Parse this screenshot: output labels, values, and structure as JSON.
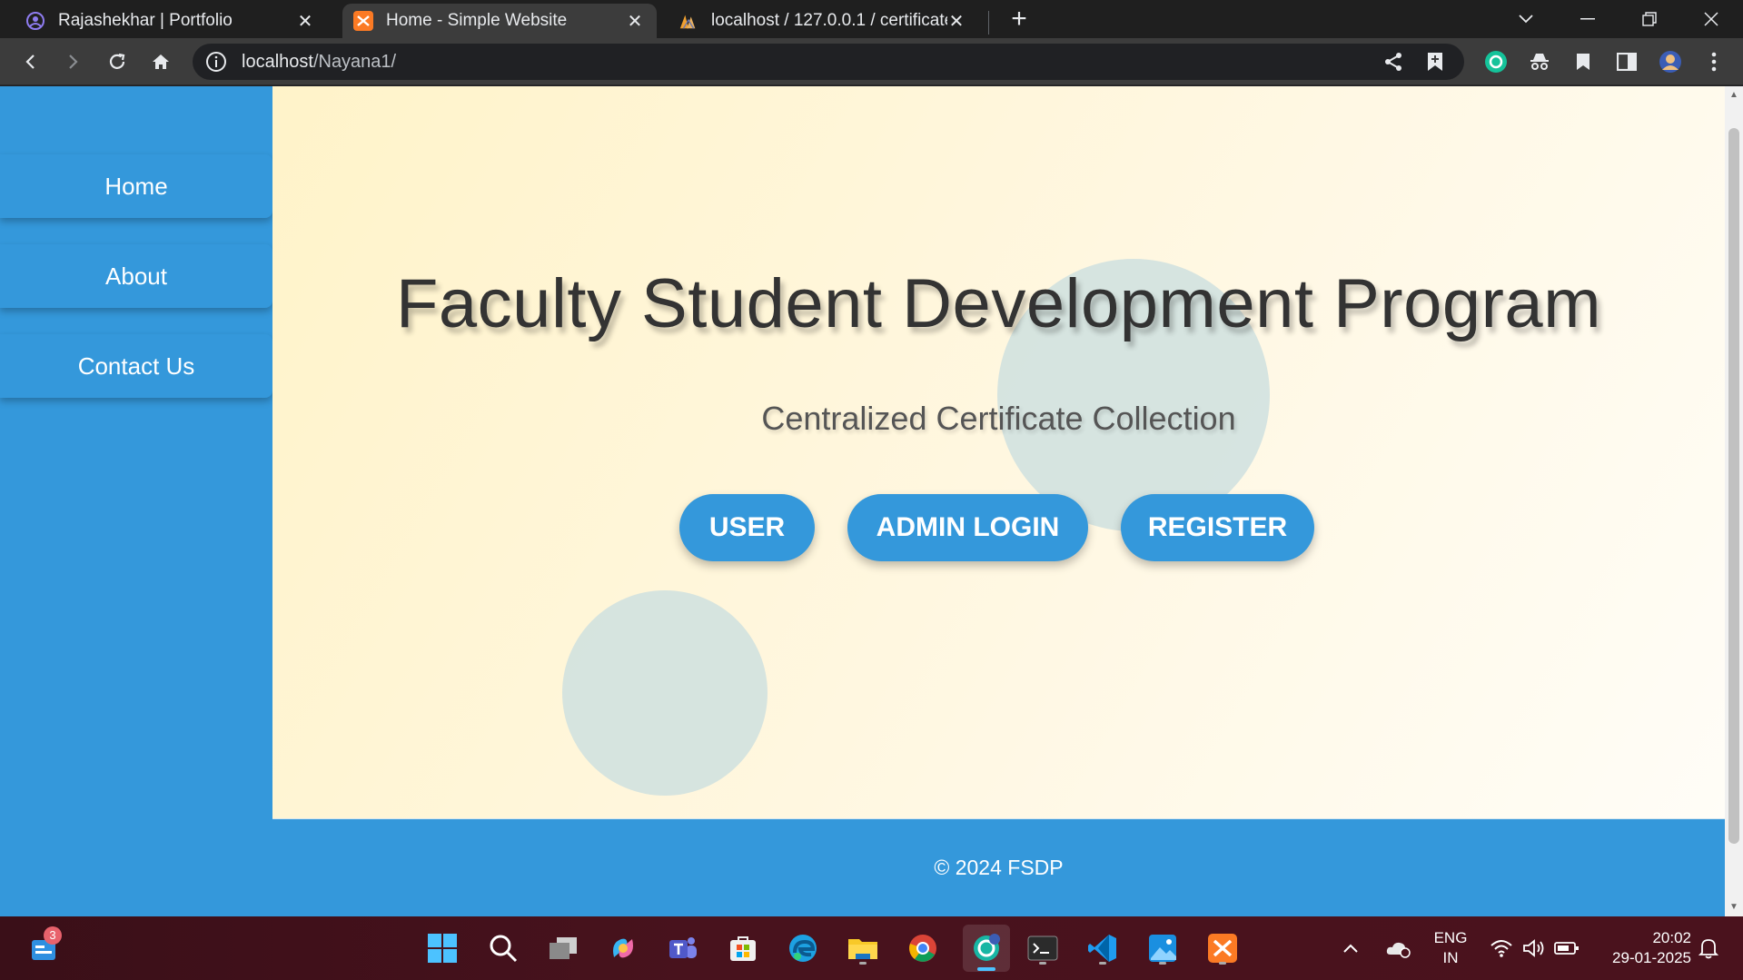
{
  "browser": {
    "tabs": [
      {
        "title": "Rajashekhar | Portfolio",
        "favicon": "portfolio-icon"
      },
      {
        "title": "Home - Simple Website",
        "favicon": "xampp-icon"
      },
      {
        "title": "localhost / 127.0.0.1 / certificate",
        "favicon": "phpmyadmin-icon"
      }
    ],
    "address": {
      "host": "localhost",
      "path": "/Nayana1/"
    }
  },
  "sidebar": {
    "items": [
      {
        "label": "Home"
      },
      {
        "label": "About"
      },
      {
        "label": "Contact Us"
      }
    ]
  },
  "hero": {
    "title": "Faculty Student Development Program",
    "subtitle": "Centralized Certificate Collection",
    "buttons": [
      {
        "label": "USER"
      },
      {
        "label": "ADMIN LOGIN"
      },
      {
        "label": "REGISTER"
      }
    ]
  },
  "footer": {
    "text": "© 2024 FSDP"
  },
  "taskbar": {
    "widget_badge": "3",
    "language": {
      "line1": "ENG",
      "line2": "IN"
    },
    "clock": {
      "time": "20:02",
      "date": "29-01-2025"
    }
  },
  "colors": {
    "brand": "#3498db",
    "hero_bg": "#fff5d6",
    "circle": "#cfe0df",
    "taskbar": "#48121d"
  }
}
